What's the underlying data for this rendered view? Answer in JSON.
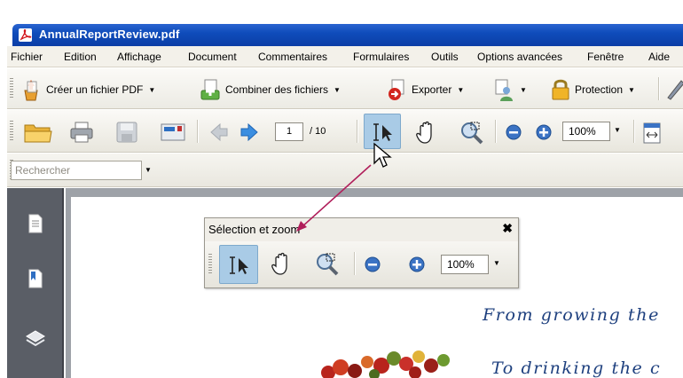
{
  "window": {
    "title": "AnnualReportReview.pdf"
  },
  "menu": [
    "Fichier",
    "Edition",
    "Affichage",
    "Document",
    "Commentaires",
    "Formulaires",
    "Outils",
    "Options avancées",
    "Fenêtre",
    "Aide"
  ],
  "tasks_toolbar": {
    "create_pdf": "Créer un fichier PDF",
    "combine": "Combiner des fichiers",
    "export": "Exporter",
    "protection": "Protection"
  },
  "file_toolbar": {
    "page_current": "1",
    "page_total": "/ 10",
    "zoom": "100%"
  },
  "search": {
    "placeholder": "Rechercher"
  },
  "floating_toolbar": {
    "title": "Sélection et zoom",
    "close": "✖",
    "zoom": "100%"
  },
  "document": {
    "line1": "From growing the",
    "line2": "To drinking the c"
  },
  "colors": {
    "title_bar": "#0f4cbb",
    "callout_arrow": "#b01e5a",
    "selected_tool": "#a9cbe6",
    "script_text": "#1d3f7e"
  }
}
